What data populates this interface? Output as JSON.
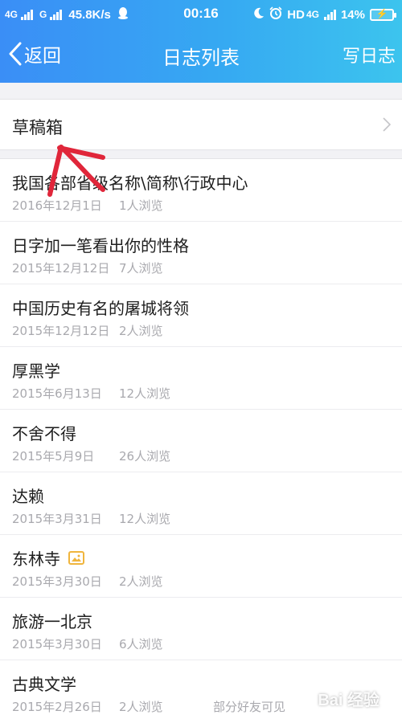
{
  "status_bar": {
    "left_network_1": "4G",
    "left_network_2": "G",
    "speed": "45.8K/s",
    "time": "00:16",
    "hd": "HD",
    "network_4g": "4G",
    "battery": "14%"
  },
  "nav": {
    "back_label": "返回",
    "title": "日志列表",
    "action_label": "写日志"
  },
  "drafts": {
    "label": "草稿箱"
  },
  "diaries": [
    {
      "title": "我国各部省级名称\\简称\\行政中心",
      "date": "2016年12月1日",
      "views": "1人浏览",
      "extra": ""
    },
    {
      "title": "日字加一笔看出你的性格",
      "date": "2015年12月12日",
      "views": "7人浏览",
      "extra": ""
    },
    {
      "title": "中国历史有名的屠城将领",
      "date": "2015年12月12日",
      "views": "2人浏览",
      "extra": ""
    },
    {
      "title": "厚黑学",
      "date": "2015年6月13日",
      "views": "12人浏览",
      "extra": ""
    },
    {
      "title": "不舍不得",
      "date": "2015年5月9日",
      "views": "26人浏览",
      "extra": ""
    },
    {
      "title": "达赖",
      "date": "2015年3月31日",
      "views": "12人浏览",
      "extra": ""
    },
    {
      "title": "东林寺",
      "date": "2015年3月30日",
      "views": "2人浏览",
      "extra": ""
    },
    {
      "title": "旅游一北京",
      "date": "2015年3月30日",
      "views": "6人浏览",
      "extra": ""
    },
    {
      "title": "古典文学",
      "date": "2015年2月26日",
      "views": "2人浏览",
      "extra": "部分好友可见"
    }
  ],
  "watermark": "Bai 经验",
  "colors": {
    "header_start": "#3a8ef6",
    "header_end": "#3cc4ee",
    "annotation_red": "#e0263a",
    "image_badge": "#f0b53d"
  }
}
